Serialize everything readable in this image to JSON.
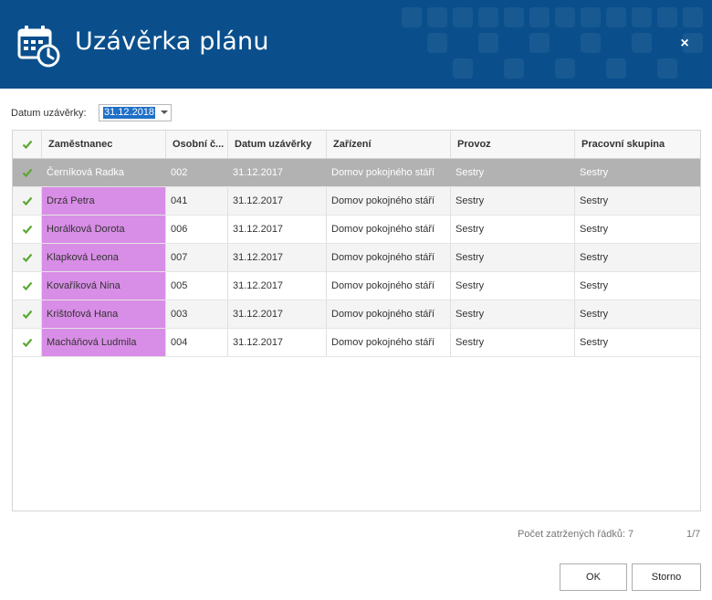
{
  "header": {
    "title": "Uzávěrka plánu",
    "icon": "calendar-clock-icon",
    "close_label": "×",
    "color": "#0a4f8c"
  },
  "date_filter": {
    "label": "Datum uzávěrky:",
    "value": "31.12.2018"
  },
  "grid": {
    "columns": [
      "Zaměstnanec",
      "Osobní č...",
      "Datum uzávěrky",
      "Zařízení",
      "Provoz",
      "Pracovní skupina"
    ],
    "rows": [
      {
        "name": "Černíková Radka",
        "id": "002",
        "date": "31.12.2017",
        "facility": "Domov pokojného stáří",
        "operation": "Sestry",
        "group": "Sestry",
        "selected": true
      },
      {
        "name": "Drzá Petra",
        "id": "041",
        "date": "31.12.2017",
        "facility": "Domov pokojného stáří",
        "operation": "Sestry",
        "group": "Sestry"
      },
      {
        "name": "Horálková Dorota",
        "id": "006",
        "date": "31.12.2017",
        "facility": "Domov pokojného stáří",
        "operation": "Sestry",
        "group": "Sestry"
      },
      {
        "name": "Klapková Leona",
        "id": "007",
        "date": "31.12.2017",
        "facility": "Domov pokojného stáří",
        "operation": "Sestry",
        "group": "Sestry"
      },
      {
        "name": "Kovaříková Nina",
        "id": "005",
        "date": "31.12.2017",
        "facility": "Domov pokojného stáří",
        "operation": "Sestry",
        "group": "Sestry"
      },
      {
        "name": "Krištofová Hana",
        "id": "003",
        "date": "31.12.2017",
        "facility": "Domov pokojného stáří",
        "operation": "Sestry",
        "group": "Sestry"
      },
      {
        "name": "Macháňová Ludmila",
        "id": "004",
        "date": "31.12.2017",
        "facility": "Domov pokojného stáří",
        "operation": "Sestry",
        "group": "Sestry"
      }
    ],
    "check_color": "#5aa832",
    "highlight_color": "#d88de6",
    "selected_color": "#b2b2b2"
  },
  "footer": {
    "count_text": "Počet zatržených řádků: 7",
    "page_text": "1/7",
    "ok_label": "OK",
    "cancel_label": "Storno"
  }
}
